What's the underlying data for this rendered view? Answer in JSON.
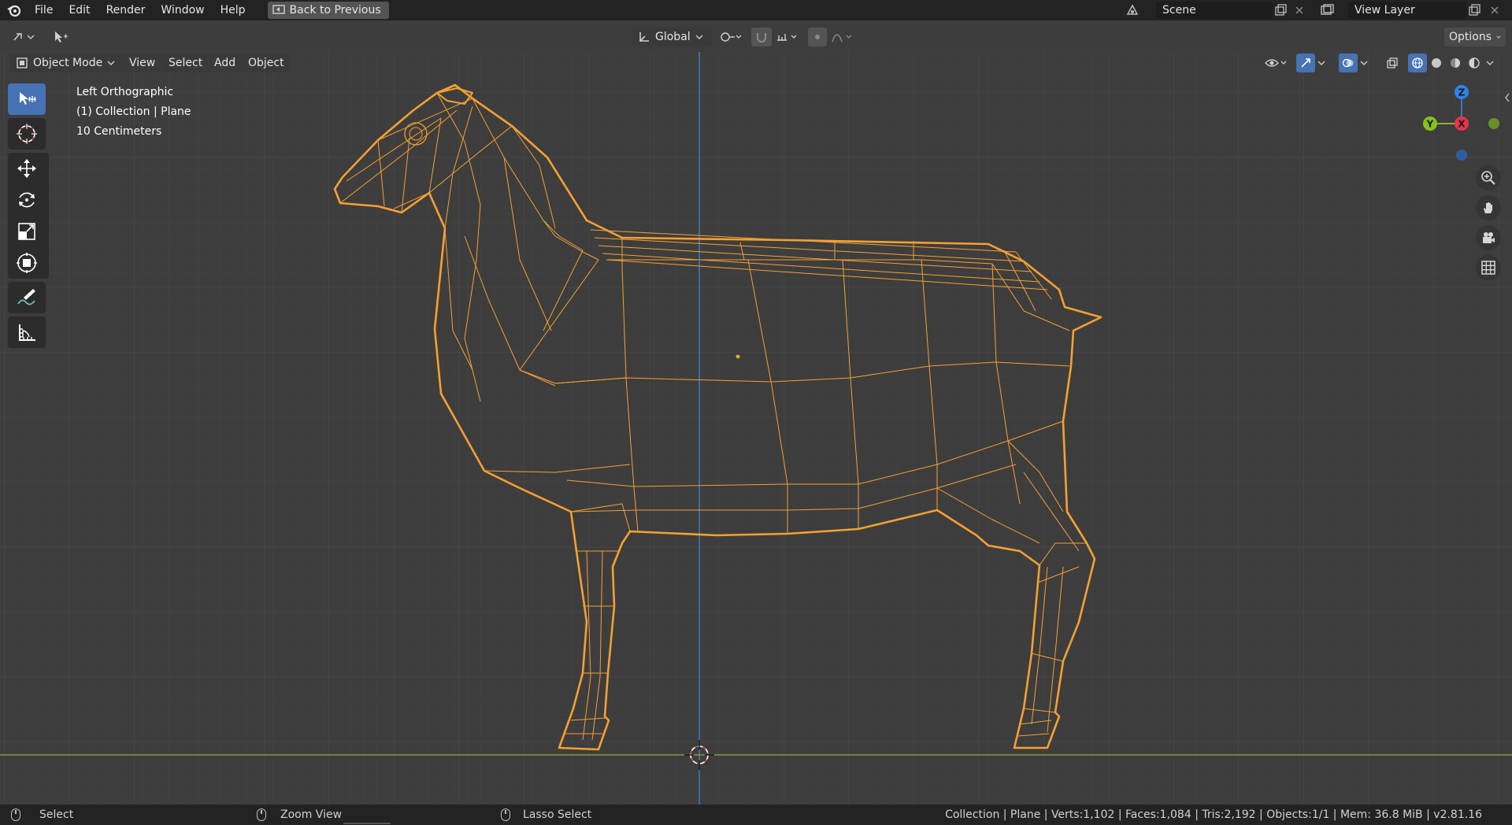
{
  "topbar": {
    "menus": [
      "File",
      "Edit",
      "Render",
      "Window",
      "Help"
    ],
    "back_label": "Back to Previous",
    "scene_name": "Scene",
    "view_layer_name": "View Layer"
  },
  "tool_header": {
    "transform_orientation": "Global",
    "options_label": "Options"
  },
  "viewport_header": {
    "mode": "Object Mode",
    "menus": [
      "View",
      "Select",
      "Add",
      "Object"
    ]
  },
  "viewport": {
    "view_name": "Left Orthographic",
    "collection_info": "(1) Collection | Plane",
    "grid_scale": "10 Centimeters",
    "gizmo": {
      "z": "Z",
      "y": "Y",
      "x": "X"
    },
    "wire_color": "#f5a031",
    "x_axis_color": "#8fae35",
    "z_axis_color": "#3c7cb8"
  },
  "tools": [
    "select-box-icon",
    "cursor-icon",
    "move-icon",
    "rotate-icon",
    "scale-icon",
    "transform-icon",
    "annotate-icon",
    "measure-icon"
  ],
  "statusbar": {
    "left_action": "Select",
    "middle_action": "Zoom View",
    "right_action": "Lasso Select",
    "stats": "Collection | Plane | Verts:1,102 | Faces:1,084 | Tris:2,192 | Objects:1/1 | Mem: 36.8 MiB | v2.81.16"
  }
}
